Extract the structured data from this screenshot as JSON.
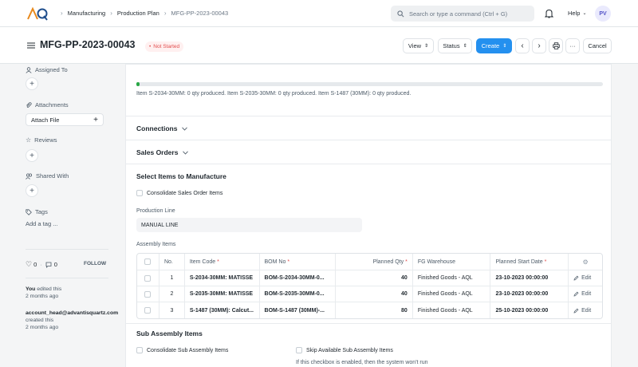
{
  "navbar": {
    "breadcrumbs": [
      "Manufacturing",
      "Production Plan",
      "MFG-PP-2023-00043"
    ],
    "search_placeholder": "Search or type a command (Ctrl + G)",
    "help_label": "Help",
    "avatar_initials": "PV"
  },
  "header": {
    "title": "MFG-PP-2023-00043",
    "status": "Not Started",
    "view_label": "View",
    "status_label": "Status",
    "create_label": "Create",
    "cancel_label": "Cancel"
  },
  "sidebar": {
    "assigned_to": "Assigned To",
    "attachments": "Attachments",
    "attach_file": "Attach File",
    "reviews": "Reviews",
    "shared_with": "Shared With",
    "tags": "Tags",
    "add_tag": "Add a tag ...",
    "likes_count": "0",
    "comments_count": "0",
    "follow": "FOLLOW",
    "activity": [
      {
        "actor": "You",
        "action": "edited this",
        "time": "2 months ago"
      },
      {
        "actor": "account_head@advantisquartz.com",
        "action": "created this",
        "time": "2 months ago"
      }
    ]
  },
  "main": {
    "progress_fraction": 0.006,
    "progress_text": "Item S-2034-30MM: 0 qty produced. Item S-2035-30MM: 0 qty produced. Item S-1487 (30MM): 0 qty produced.",
    "connections": "Connections",
    "sales_orders": "Sales Orders",
    "select_items_title": "Select Items to Manufacture",
    "consolidate_so": "Consolidate Sales Order Items",
    "production_line_label": "Production Line",
    "production_line_value": "MANUAL LINE",
    "assembly_items_label": "Assembly Items",
    "sub_assembly_title": "Sub Assembly Items",
    "consolidate_sub": "Consolidate Sub Assembly Items",
    "skip_available": "Skip Available Sub Assembly Items",
    "skip_note": "If this checkbox is enabled, then the system won't run"
  },
  "table": {
    "headers": {
      "no": "No.",
      "item_code": "Item Code",
      "bom_no": "BOM No",
      "planned_qty": "Planned Qty",
      "fg_warehouse": "FG Warehouse",
      "planned_start": "Planned Start Date"
    },
    "edit_label": "Edit",
    "rows": [
      {
        "no": "1",
        "item_code": "S-2034-30MM: MATISSE",
        "bom_no": "BOM-S-2034-30MM-0...",
        "qty": "40",
        "warehouse": "Finished Goods - AQL",
        "start": "23-10-2023 00:00:00"
      },
      {
        "no": "2",
        "item_code": "S-2035-30MM: MATISSE",
        "bom_no": "BOM-S-2035-30MM-0...",
        "qty": "40",
        "warehouse": "Finished Goods - AQL",
        "start": "23-10-2023 00:00:00"
      },
      {
        "no": "3",
        "item_code": "S-1487 (30MM): Calcut...",
        "bom_no": "BOM-S-1487 (30MM)-...",
        "qty": "80",
        "warehouse": "Finished Goods - AQL",
        "start": "25-10-2023 00:00:00"
      }
    ]
  },
  "colors": {
    "primary": "#2490ef",
    "status_red": "#e24c4c",
    "progress_green": "#28a745"
  }
}
